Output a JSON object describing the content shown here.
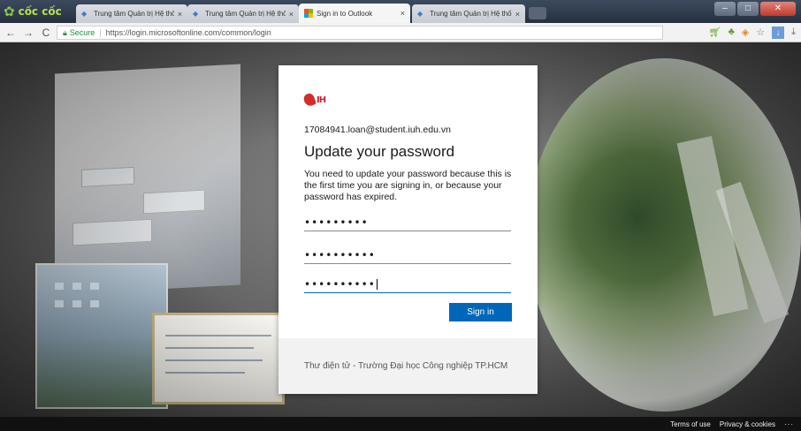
{
  "browser": {
    "brand": "cốc cốc",
    "tabs": [
      {
        "label": "Trung tâm Quản trị Hệ thố",
        "close": "×",
        "active": false
      },
      {
        "label": "Trung tâm Quản trị Hệ thố",
        "close": "×",
        "active": false
      },
      {
        "label": "Sign in to Outlook",
        "close": "×",
        "active": true
      },
      {
        "label": "Trung tâm Quản trị Hệ thố",
        "close": "×",
        "active": false
      }
    ],
    "address": {
      "secure_label": "Secure",
      "separator": "|",
      "url": "https://login.microsoftonline.com/common/login"
    },
    "nav": {
      "back": "←",
      "forward": "→",
      "reload": "C"
    },
    "toolbar_icons": [
      "cart-icon",
      "leaf-icon",
      "shield-icon",
      "star-icon",
      "download-icon"
    ],
    "window_controls": [
      "minimize",
      "maximize",
      "close"
    ]
  },
  "card": {
    "account": "17084941.loan@student.iuh.edu.vn",
    "title": "Update your password",
    "description": "You need to update your password because this is the first time you are signing in, or because your password has expired.",
    "fields": {
      "current_password": "•••••••••",
      "new_password": "••••••••••",
      "confirm_password": "••••••••••"
    },
    "signin_label": "Sign in",
    "footer": "Thư điện tử - Trường Đại học Công nghiệp TP.HCM"
  },
  "footer": {
    "terms": "Terms of use",
    "privacy": "Privacy & cookies",
    "more": "···"
  },
  "colors": {
    "primary": "#0067b8",
    "brand_green": "#b8e04a"
  }
}
